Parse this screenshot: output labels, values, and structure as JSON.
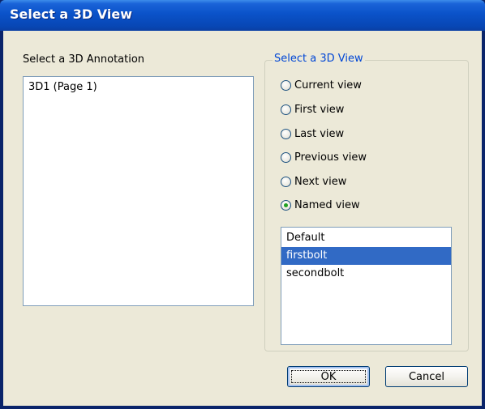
{
  "window": {
    "title": "Select a 3D View"
  },
  "annotation_panel": {
    "label": "Select a 3D Annotation",
    "items": [
      "3D1 (Page 1)"
    ]
  },
  "view_group": {
    "legend": "Select a 3D View",
    "options": [
      {
        "label": "Current view",
        "checked": false
      },
      {
        "label": "First view",
        "checked": false
      },
      {
        "label": "Last view",
        "checked": false
      },
      {
        "label": "Previous view",
        "checked": false
      },
      {
        "label": "Next view",
        "checked": false
      },
      {
        "label": "Named view",
        "checked": true
      }
    ],
    "named_views": {
      "items": [
        "Default",
        "firstbolt",
        "secondbolt"
      ],
      "selected": "firstbolt"
    }
  },
  "buttons": {
    "ok": "OK",
    "cancel": "Cancel"
  },
  "colors": {
    "title_bar": "#0a52c9",
    "selection": "#316ac5",
    "group_legend": "#0046d5",
    "dialog_face": "#ece9d8"
  }
}
